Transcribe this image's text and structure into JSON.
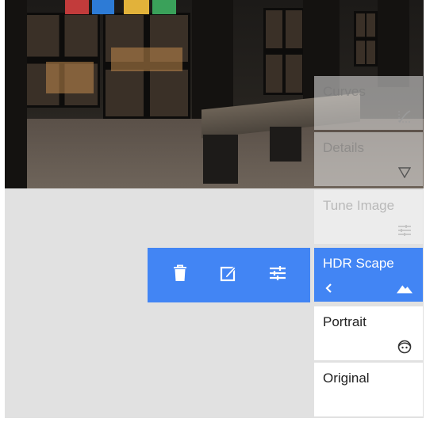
{
  "actions": {
    "items": [
      {
        "icon": "trash-icon"
      },
      {
        "icon": "edit-icon"
      },
      {
        "icon": "tune-sliders-icon"
      }
    ]
  },
  "filters": {
    "items": [
      {
        "label": "Curves",
        "icon": "curves-icon",
        "state": "faded"
      },
      {
        "label": "Details",
        "icon": "triangle-down-icon",
        "state": "faded"
      },
      {
        "label": "Tune Image",
        "icon": "tune-sliders-icon",
        "state": "faded-light"
      },
      {
        "label": "HDR Scape",
        "icon": "mountain-icon",
        "state": "selected"
      },
      {
        "label": "Portrait",
        "icon": "face-icon",
        "state": "plain"
      },
      {
        "label": "Original",
        "icon": "",
        "state": "plain"
      }
    ]
  },
  "colors": {
    "accent": "#4285f4",
    "background": "#e1e1e1"
  }
}
